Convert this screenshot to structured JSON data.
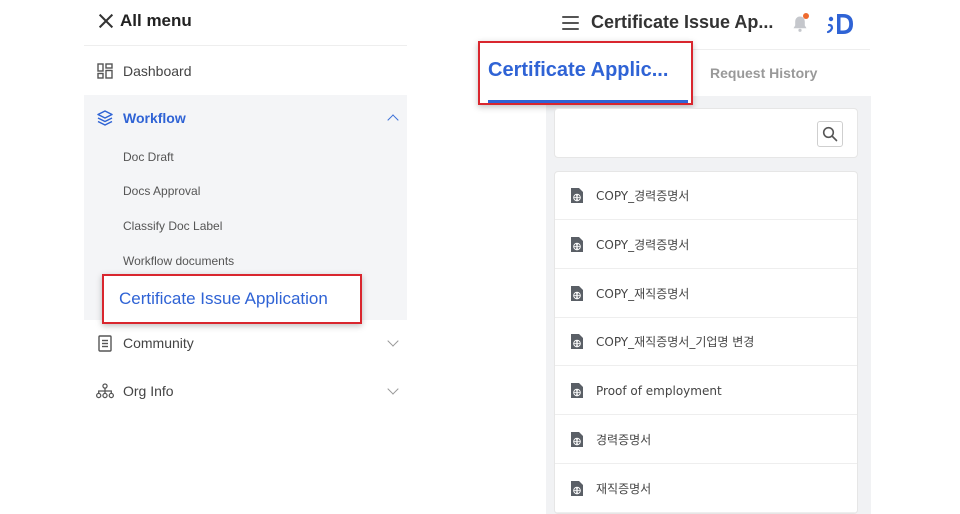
{
  "left_menu": {
    "title": "All menu",
    "items": [
      {
        "label": "Dashboard",
        "icon": "dashboard-icon"
      },
      {
        "label": "Workflow",
        "icon": "layers-icon",
        "expanded": true,
        "sub_items": [
          "Doc Draft",
          "Docs Approval",
          "Classify Doc Label",
          "Workflow documents",
          "Certificate Issue Application"
        ]
      },
      {
        "label": "Community",
        "icon": "document-list-icon"
      },
      {
        "label": "Org Info",
        "icon": "org-chart-icon"
      }
    ]
  },
  "header": {
    "title": "Certificate Issue Ap...",
    "notification_dot_color": "#ee6a2e"
  },
  "tabs": [
    {
      "label": "Certificate Applic...",
      "active": true
    },
    {
      "label": "Request History",
      "active": false
    }
  ],
  "list": [
    {
      "label": "COPY_경력증명서"
    },
    {
      "label": "COPY_경력증명서"
    },
    {
      "label": "COPY_재직증명서"
    },
    {
      "label": "COPY_재직증명서_기업명 변경"
    },
    {
      "label": "Proof of employment"
    },
    {
      "label": "경력증명서"
    },
    {
      "label": "재직증명서"
    }
  ],
  "colors": {
    "accent": "#2f63d5",
    "highlight_border": "#d9262e"
  }
}
